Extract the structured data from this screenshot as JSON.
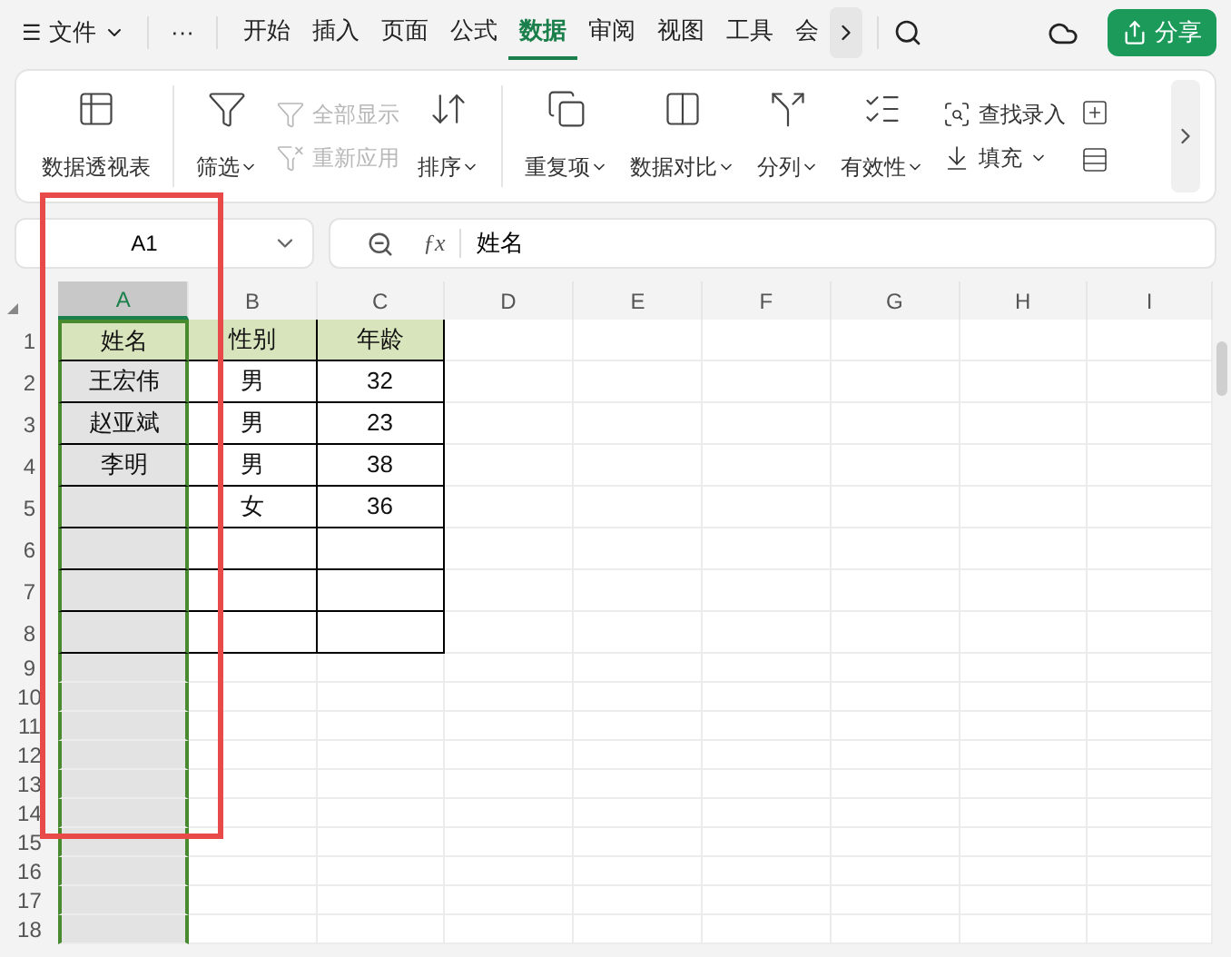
{
  "menu": {
    "icon": "☰",
    "label": "文件",
    "more": "···"
  },
  "tabs": [
    {
      "label": "开始",
      "selected": false
    },
    {
      "label": "插入",
      "selected": false
    },
    {
      "label": "页面",
      "selected": false
    },
    {
      "label": "公式",
      "selected": false
    },
    {
      "label": "数据",
      "selected": true
    },
    {
      "label": "审阅",
      "selected": false
    },
    {
      "label": "视图",
      "selected": false
    },
    {
      "label": "工具",
      "selected": false
    },
    {
      "label": "会",
      "selected": false
    }
  ],
  "share_button": "分享",
  "ribbon": [
    {
      "kind": "big",
      "label": "数据透视表",
      "caret": false
    },
    {
      "kind": "big",
      "label": "筛选",
      "caret": true
    },
    {
      "kind": "stack",
      "items": [
        {
          "label": "全部显示",
          "disabled": true,
          "caret": false
        },
        {
          "label": "重新应用",
          "disabled": true,
          "caret": false
        }
      ]
    },
    {
      "kind": "big",
      "label": "排序",
      "caret": true
    },
    {
      "kind": "big",
      "label": "重复项",
      "caret": true
    },
    {
      "kind": "big",
      "label": "数据对比",
      "caret": true
    },
    {
      "kind": "big",
      "label": "分列",
      "caret": true
    },
    {
      "kind": "big",
      "label": "有效性",
      "caret": true
    },
    {
      "kind": "stack",
      "items": [
        {
          "label": "查找录入",
          "disabled": false,
          "caret": false
        },
        {
          "label": "填充",
          "disabled": false,
          "caret": true
        }
      ]
    }
  ],
  "name_box": "A1",
  "fx": "ƒx",
  "formula": "姓名",
  "columns": [
    {
      "label": "A",
      "selected": true
    },
    {
      "label": "B",
      "selected": false
    },
    {
      "label": "C",
      "selected": false
    },
    {
      "label": "D",
      "selected": false
    },
    {
      "label": "E",
      "selected": false
    },
    {
      "label": "F",
      "selected": false
    },
    {
      "label": "G",
      "selected": false
    },
    {
      "label": "H",
      "selected": false
    },
    {
      "label": "I",
      "selected": false
    }
  ],
  "rows": [
    {
      "label": "1",
      "kind": "header",
      "cells": [
        "姓名",
        "性别",
        "年龄"
      ]
    },
    {
      "label": "2",
      "kind": "data",
      "cells": [
        "王宏伟",
        "男",
        "32"
      ]
    },
    {
      "label": "3",
      "kind": "data",
      "cells": [
        "赵亚斌",
        "男",
        "23"
      ]
    },
    {
      "label": "4",
      "kind": "data",
      "cells": [
        "李明",
        "男",
        "38"
      ]
    },
    {
      "label": "5",
      "kind": "data",
      "cells": [
        "",
        "女",
        "36"
      ]
    },
    {
      "label": "6",
      "kind": "data",
      "cells": [
        "",
        "",
        ""
      ]
    },
    {
      "label": "7",
      "kind": "data",
      "cells": [
        "",
        "",
        ""
      ]
    },
    {
      "label": "8",
      "kind": "data",
      "cells": [
        "",
        "",
        ""
      ]
    },
    {
      "label": "9",
      "kind": "blank"
    },
    {
      "label": "10",
      "kind": "blank"
    },
    {
      "label": "11",
      "kind": "blank"
    },
    {
      "label": "12",
      "kind": "blank"
    },
    {
      "label": "13",
      "kind": "blank"
    },
    {
      "label": "14",
      "kind": "blank"
    },
    {
      "label": "15",
      "kind": "blank"
    },
    {
      "label": "16",
      "kind": "blank"
    },
    {
      "label": "17",
      "kind": "blank"
    },
    {
      "label": "18",
      "kind": "blank"
    }
  ]
}
